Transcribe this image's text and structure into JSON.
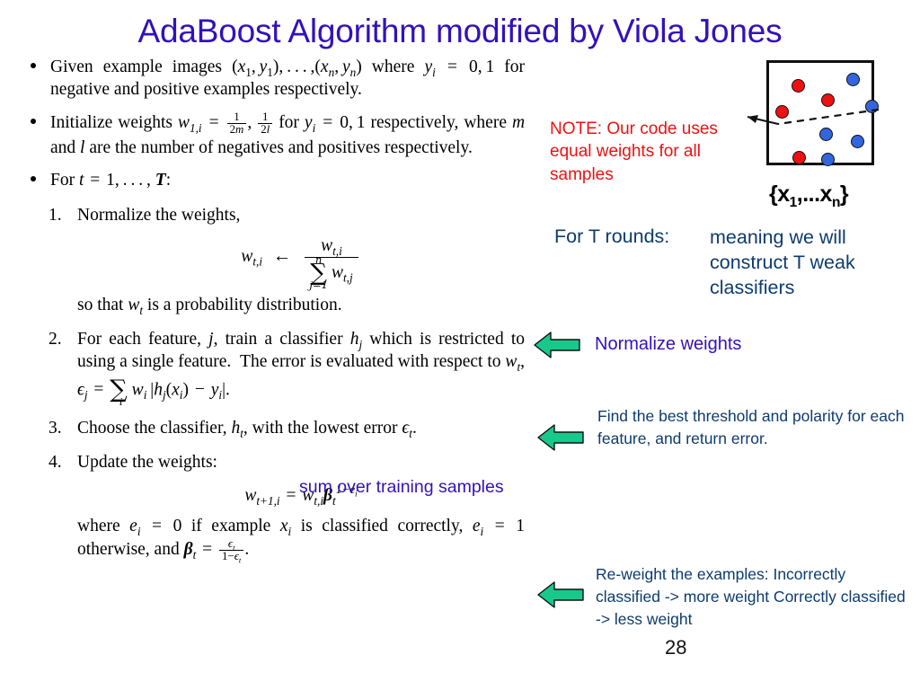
{
  "title": "AdaBoost Algorithm modified by Viola Jones",
  "page_number": "28",
  "colors": {
    "title_purple": "#3311bb",
    "note_red": "#ee1111",
    "annotation_navy": "#0d3c6e",
    "arrow_green": "#17c98a",
    "dot_red": "#ee1111",
    "dot_blue": "#3366dd"
  },
  "algorithm": {
    "bullets": [
      {
        "id": "given-examples",
        "text": "Given example images (x1, y1), . . . , (xn, yn) where yi = 0, 1 for negative and positive examples respectively."
      },
      {
        "id": "initialize-weights",
        "text": "Initialize weights w1,i = 1/2m, 1/2l for yi = 0, 1 respectively, where m and l are the number of negatives and positives respectively."
      },
      {
        "id": "for-t-loop",
        "text": "For t = 1, . . . , T:"
      }
    ],
    "steps": [
      {
        "number": "1.",
        "heading": "Normalize the weights,",
        "equation": "wt,i <- wt,i / sum_{j=1}^{n} wt,j",
        "trailer": "so that wt is a probability distribution."
      },
      {
        "number": "2.",
        "heading": "For each feature, j, train a classifier hj which is restricted to using a single feature. The error is evaluated with respect to wt, ej = sum_i wi |hj(xi) - yi|.",
        "equation": "",
        "trailer": ""
      },
      {
        "number": "3.",
        "heading": "Choose the classifier, ht, with the lowest error et.",
        "equation": "",
        "trailer": ""
      },
      {
        "number": "4.",
        "heading": "Update the weights:",
        "equation": "wt+1,i = wt,i * beta_t^(1-ei)",
        "trailer": "where ei = 0 if example xi is classified correctly, ei = 1 otherwise, and beta_t = et / (1 - et)."
      }
    ]
  },
  "annotations": {
    "note": "NOTE: Our code uses equal weights for all samples",
    "set_label": "{x1,...xn}",
    "for_t_rounds": "For T rounds:",
    "rounds_meaning": "meaning we will construct T weak classifiers",
    "normalize_weights": "Normalize weights",
    "sum_over_samples": "sum over training samples",
    "threshold_note": "Find the best threshold and polarity for each feature, and return error.",
    "reweight_note": "Re-weight the examples: Incorrectly classified -> more weight Correctly classified -> less weight"
  },
  "scatter": {
    "points": [
      {
        "x": 22,
        "y": 16,
        "class": "red"
      },
      {
        "x": 6,
        "y": 42,
        "class": "red"
      },
      {
        "x": 51,
        "y": 31,
        "class": "red"
      },
      {
        "x": 23,
        "y": 88,
        "class": "red"
      },
      {
        "x": 75,
        "y": 10,
        "class": "blue"
      },
      {
        "x": 94,
        "y": 37,
        "class": "blue"
      },
      {
        "x": 49,
        "y": 65,
        "class": "blue"
      },
      {
        "x": 80,
        "y": 72,
        "class": "blue"
      },
      {
        "x": 51,
        "y": 90,
        "class": "blue"
      }
    ],
    "separator": "dashed decision boundary with arrow"
  }
}
